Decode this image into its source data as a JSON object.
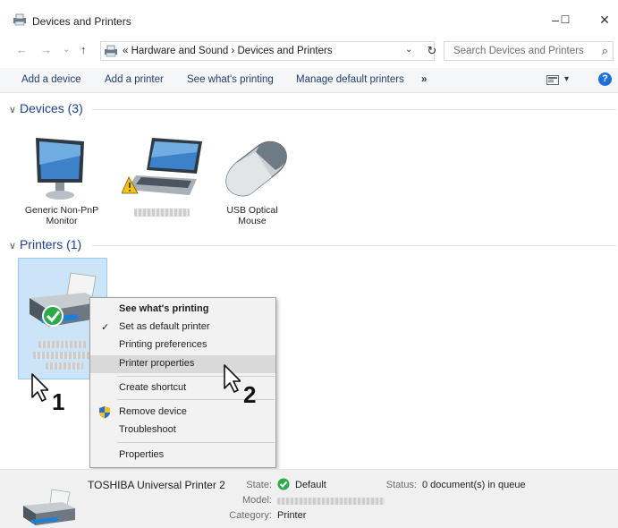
{
  "window": {
    "title": "Devices and Printers",
    "minimize": "–",
    "maximize": "☐",
    "close": "✕"
  },
  "nav": {
    "back": "←",
    "forward": "→",
    "recent": "⌄",
    "up": "↑",
    "address": "«  Hardware and Sound  ›  Devices and Printers",
    "address_dropdown": "⌄",
    "refresh": "↻",
    "search_placeholder": "Search Devices and Printers",
    "search_icon": "⌕"
  },
  "toolbar": {
    "items": [
      "Add a device",
      "Add a printer",
      "See what's printing",
      "Manage default printers",
      "»"
    ],
    "view_glyph": "▾",
    "help": "?"
  },
  "groups": {
    "devices": "Devices (3)",
    "printers": "Printers (1)"
  },
  "devices": [
    {
      "label_line1": "Generic Non-PnP",
      "label_line2": "Monitor",
      "icon": "monitor-icon"
    },
    {
      "label_line1": "",
      "label_line2": "",
      "icon": "laptop-icon"
    },
    {
      "label_line1": "USB Optical",
      "label_line2": "Mouse",
      "icon": "mouse-icon"
    }
  ],
  "context_menu": {
    "items": [
      "See what's printing",
      "Set as default printer",
      "Printing preferences",
      "Printer properties",
      "Create shortcut",
      "Remove device",
      "Troubleshoot",
      "Properties"
    ],
    "check": "✓",
    "highlighted": "Printer properties"
  },
  "callouts": {
    "one": "1",
    "two": "2"
  },
  "details": {
    "name": "TOSHIBA Universal Printer 2",
    "state_key": "State:",
    "state_value": "Default",
    "status_key": "Status:",
    "status_value": "0 document(s) in queue",
    "model_key": "Model:",
    "category_key": "Category:",
    "category_value": "Printer"
  },
  "colors": {
    "accent": "#1e3e8a",
    "selection": "#cce4f7",
    "ok_green": "#2faa4a",
    "help_blue": "#1e6fd9"
  }
}
